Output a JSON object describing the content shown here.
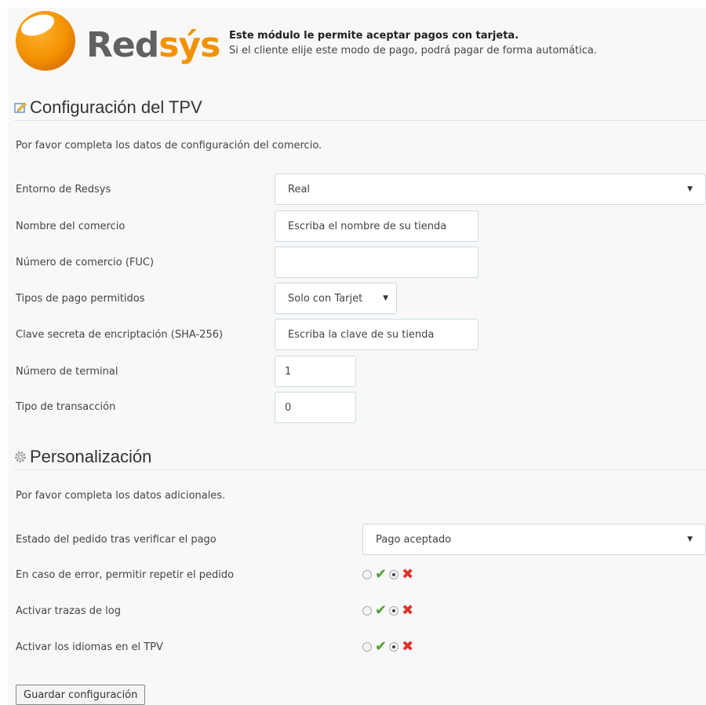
{
  "header": {
    "logo_text_a": "Red",
    "logo_text_b": "sýs",
    "intro_title": "Este módulo le permite aceptar pagos con tarjeta.",
    "intro_text": "Si el cliente elije este modo de pago, podrá pagar de forma automática."
  },
  "tpv": {
    "title": "Configuración del TPV",
    "description": "Por favor completa los datos de configuración del comercio.",
    "fields": [
      {
        "label": "Entorno de Redsys",
        "value": "Real"
      },
      {
        "label": "Nombre del comercio",
        "value": "Escriba el nombre de su tienda"
      },
      {
        "label": "Número de comercio (FUC)",
        "value": ""
      },
      {
        "label": "Tipos de pago permitidos",
        "value": "Solo con Tarjet"
      },
      {
        "label": "Clave secreta de encriptación (SHA-256)",
        "value": "Escriba la clave de su tienda"
      },
      {
        "label": "Número de terminal",
        "value": "1"
      },
      {
        "label": "Tipo de transacción",
        "value": "0"
      }
    ]
  },
  "custom": {
    "title": "Personalización",
    "description": "Por favor completa los datos adicionales.",
    "order_state": {
      "label": "Estado del pedido tras verificar el pago",
      "value": "Pago aceptado"
    },
    "toggles": [
      {
        "label": "En caso de error, permitir repetir el pedido",
        "selected": "no"
      },
      {
        "label": "Activar trazas de log",
        "selected": "no"
      },
      {
        "label": "Activar los idiomas en el TPV",
        "selected": "no"
      }
    ]
  },
  "save_label": "Guardar configuración",
  "colors": {
    "brand_orange": "#f39200",
    "ok_green": "#4aa02c",
    "no_red": "#e0312c"
  }
}
